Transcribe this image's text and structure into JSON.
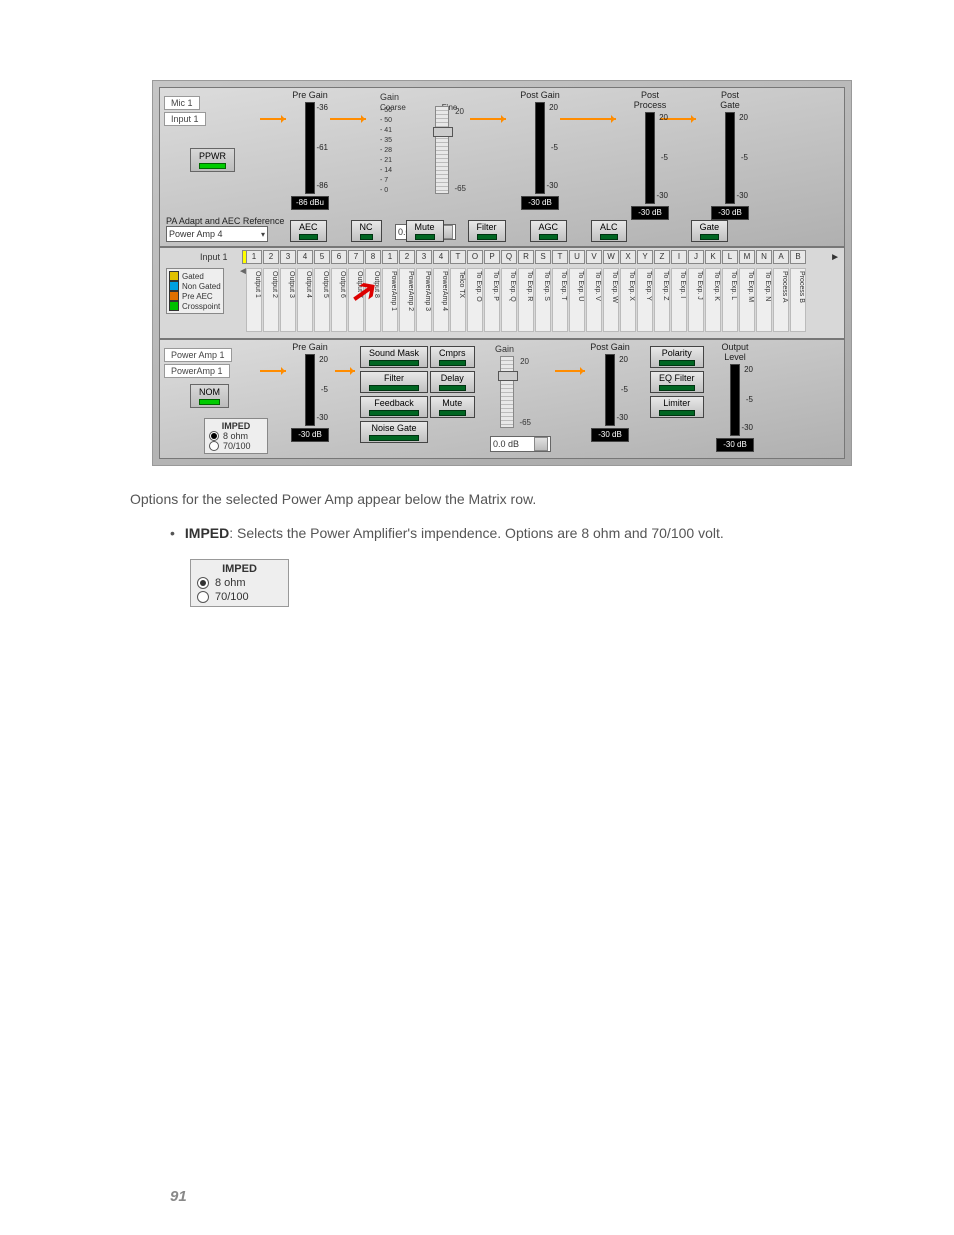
{
  "top": {
    "mic": "Mic 1",
    "input": "Input 1",
    "ppwr": "PPWR",
    "meters": [
      {
        "title": "Pre Gain",
        "t1": "-36",
        "t2": "-61",
        "t3": "-86",
        "db": "-86 dBu"
      },
      {
        "title": "Post Gain",
        "t1": "20",
        "t2": "-5",
        "t3": "-30",
        "db": "-30 dB"
      },
      {
        "title": "Post Process",
        "t1": "20",
        "t2": "-5",
        "t3": "-30",
        "db": "-30 dB"
      },
      {
        "title": "Post Gate",
        "t1": "20",
        "t2": "-5",
        "t3": "-30",
        "db": "-30 dB"
      }
    ],
    "gain": {
      "title": "Gain",
      "coarse": "Coarse",
      "fine": "Fine",
      "ft1": "20",
      "ft2": "-65",
      "ticks": [
        "- 56",
        "- 50",
        "- 41",
        "- 35",
        "- 28",
        "- 21",
        "- 14",
        "- 7",
        "- 0"
      ],
      "value": "0.0 dB"
    },
    "paref": "PA Adapt and AEC Reference",
    "combo": "Power Amp 4",
    "btns": [
      "AEC",
      "NC",
      "Mute",
      "Filter",
      "AGC",
      "ALC",
      "Gate"
    ]
  },
  "matrix": {
    "input": "Input 1",
    "yellow": [
      "0",
      "0",
      "0"
    ],
    "head": [
      "1",
      "2",
      "3",
      "4",
      "5",
      "6",
      "7",
      "8",
      "1",
      "2",
      "3",
      "4",
      "T",
      "O",
      "P",
      "Q",
      "R",
      "S",
      "T",
      "U",
      "V",
      "W",
      "X",
      "Y",
      "Z",
      "I",
      "J",
      "K",
      "L",
      "M",
      "N",
      "A",
      "B"
    ],
    "cols": [
      "Output 1",
      "Output 2",
      "Output 3",
      "Output 4",
      "Output 5",
      "Output 6",
      "Output 7",
      "Output 8",
      "PowerAmp 1",
      "PowerAmp 2",
      "PowerAmp 3",
      "PowerAmp 4",
      "Telco TX",
      "To Exp. O",
      "To Exp. P",
      "To Exp. Q",
      "To Exp. R",
      "To Exp. S",
      "To Exp. T",
      "To Exp. U",
      "To Exp. V",
      "To Exp. W",
      "To Exp. X",
      "To Exp. Y",
      "To Exp. Z",
      "To Exp. I",
      "To Exp. J",
      "To Exp. K",
      "To Exp. L",
      "To Exp. M",
      "To Exp. N",
      "Process A",
      "Process B"
    ],
    "legend": [
      [
        "#e0c000",
        "Gated"
      ],
      [
        "#00a0e0",
        "Non Gated"
      ],
      [
        "#e07000",
        "Pre AEC"
      ],
      [
        "#00c000",
        "Crosspoint"
      ]
    ]
  },
  "bottom": {
    "pa": "Power Amp 1",
    "paInput": "PowerAmp 1",
    "nom": "NOM",
    "imped": {
      "title": "IMPED",
      "o1": "8 ohm",
      "o2": "70/100"
    },
    "meters": [
      {
        "title": "Pre Gain",
        "t1": "20",
        "t2": "-5",
        "t3": "-30",
        "db": "-30 dB"
      },
      {
        "title": "Post Gain",
        "t1": "20",
        "t2": "-5",
        "t3": "-30",
        "db": "-30 dB"
      },
      {
        "title": "Output Level",
        "t1": "20",
        "t2": "-5",
        "t3": "-30",
        "db": "-30 dB"
      }
    ],
    "outbtns1": [
      "Sound Mask",
      "Filter",
      "Feedback",
      "Noise Gate"
    ],
    "outbtns2": [
      "Cmprs",
      "Delay",
      "Mute"
    ],
    "outbtns3": [
      "Polarity",
      "EQ Filter",
      "Limiter"
    ],
    "gain": {
      "title": "Gain",
      "t1": "20",
      "t2": "-65",
      "value": "0.0 dB"
    }
  },
  "text": {
    "p1": "Options for the selected Power Amp appear below the Matrix row.",
    "b1a": "IMPED",
    "b1b": ": Selects the Power Amplifier's impendence. Options are 8 ohm and 70/100 volt."
  },
  "imped_lg": {
    "title": "IMPED",
    "o1": "8 ohm",
    "o2": "70/100"
  },
  "page": "91"
}
